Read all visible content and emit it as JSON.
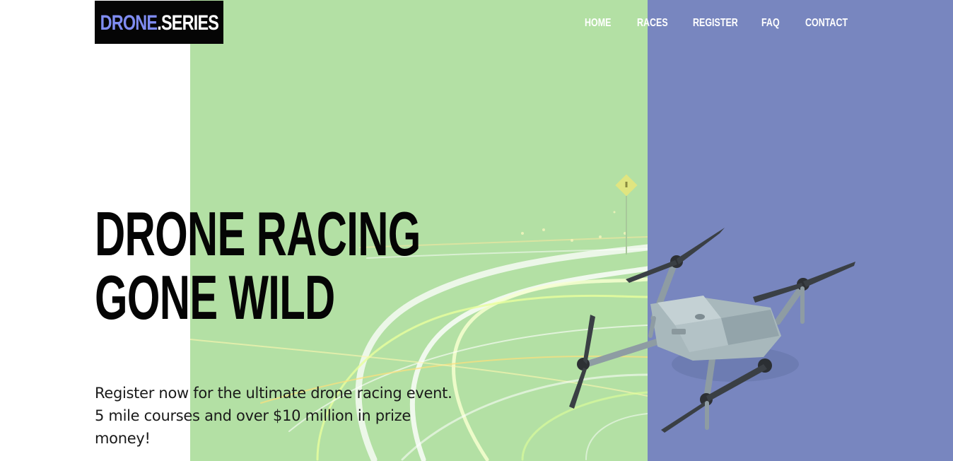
{
  "brand": {
    "logo_part1": "DRONE",
    "logo_part2": ".SERIES"
  },
  "nav": {
    "items": [
      "HOME",
      "RACES",
      "REGISTER",
      "FAQ",
      "CONTACT"
    ]
  },
  "hero": {
    "headline_line1": "DRONE RACING",
    "headline_line2": "GONE WILD",
    "subtext": "Register now for the ultimate drone racing event. 5 mile courses and over $10 million in prize money!"
  },
  "colors": {
    "green_panel": "#b3e0a4",
    "blue_panel": "#7886bf",
    "logo_accent": "#7f8cf2",
    "logo_bg": "#050505"
  },
  "images": [
    "light-trails-photo",
    "drone-photo"
  ]
}
